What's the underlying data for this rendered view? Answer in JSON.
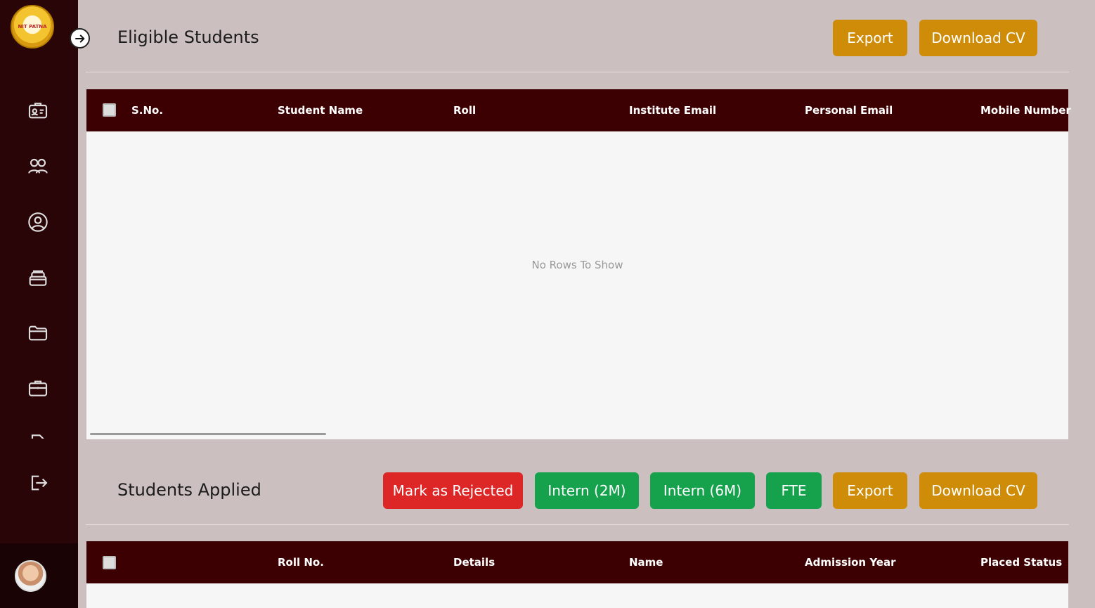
{
  "sidebar": {
    "logo_text": "NIT PATNA",
    "icons": [
      "id-card-icon",
      "users-icon",
      "user-circle-icon",
      "inbox-stack-icon",
      "folder-icon",
      "briefcase-icon",
      "document-icon",
      "logout-icon"
    ]
  },
  "eligible": {
    "title": "Eligible Students",
    "export_label": "Export",
    "download_label": "Download CV",
    "columns": [
      "S.No.",
      "Student Name",
      "Roll",
      "Institute Email",
      "Personal Email",
      "Mobile Number"
    ],
    "empty_message": "No Rows To Show"
  },
  "applied": {
    "title": "Students Applied",
    "reject_label": "Mark as Rejected",
    "intern2m_label": "Intern (2M)",
    "intern6m_label": "Intern (6M)",
    "fte_label": "FTE",
    "export_label": "Export",
    "download_label": "Download CV",
    "columns": [
      "Roll No.",
      "Details",
      "Name",
      "Admission Year",
      "Placed Status"
    ]
  },
  "colors": {
    "sidebar_bg": "#2a0507",
    "header_bg": "#3d0002",
    "accent_yellow": "#cf8c08",
    "accent_red": "#dd2726",
    "accent_green": "#16a24c",
    "page_bg": "#cbbfbf"
  }
}
